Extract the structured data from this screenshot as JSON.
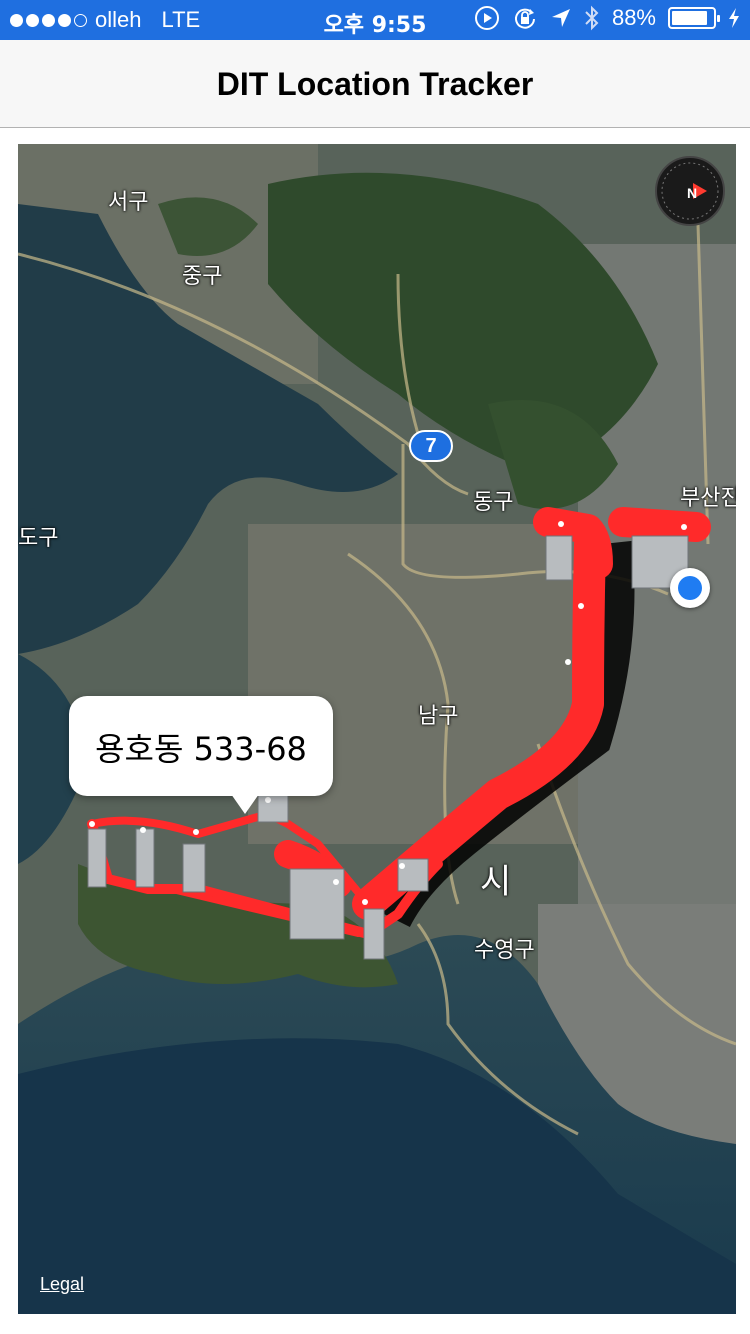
{
  "status_bar": {
    "carrier": "olleh",
    "network": "LTE",
    "time": "오후 9:55",
    "battery_percent": "88%",
    "battery_level": 0.88,
    "signal_bars_filled": 4,
    "signal_bars_total": 5,
    "icons": [
      "screen-record-icon",
      "rotation-lock-icon",
      "location-arrow-icon",
      "bluetooth-icon",
      "battery-icon",
      "charging-icon"
    ]
  },
  "nav": {
    "title": "DIT Location Tracker"
  },
  "map": {
    "labels": {
      "seo_gu": "서구",
      "jung_gu": "중구",
      "dong_gu": "동구",
      "busanjin": "부산진",
      "saha": "도구",
      "nam_gu": "남구",
      "suyeong_gu": "수영구",
      "city": "시"
    },
    "route_badge": "7",
    "compass_label": "N",
    "legal": "Legal",
    "callout": "용호동 533-68",
    "route_color": "#ff2a2a",
    "water_color": "#1d3a4a"
  }
}
